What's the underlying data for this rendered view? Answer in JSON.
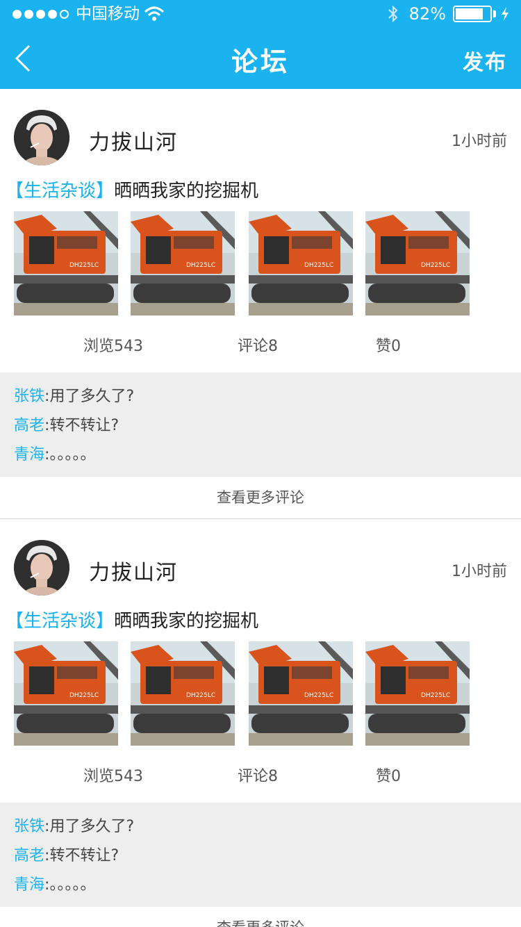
{
  "status_bar": {
    "carrier": "中国移动",
    "battery_percent": "82%",
    "battery_level": 0.82
  },
  "nav": {
    "title": "论坛",
    "publish_label": "发布"
  },
  "colors": {
    "accent": "#1ab2ef",
    "comment_bg": "#eeeeee",
    "excavator_orange": "#d9541c"
  },
  "posts": [
    {
      "username": "力拔山河",
      "time": "1小时前",
      "category": "【生活杂谈】",
      "title": "晒晒我家的挖掘机",
      "image_icon": "excavator-photo",
      "image_count": 4,
      "stats": {
        "views": "浏览543",
        "comments": "评论8",
        "likes": "赞0"
      },
      "comments": [
        {
          "user": "张铁",
          "sep": ":",
          "text": "用了多久了?"
        },
        {
          "user": "高老",
          "sep": ":",
          "text": "转不转让?"
        },
        {
          "user": "青海",
          "sep": ":",
          "text": "。。。。。"
        }
      ],
      "more_label": "查看更多评论"
    },
    {
      "username": "力拔山河",
      "time": "1小时前",
      "category": "【生活杂谈】",
      "title": "晒晒我家的挖掘机",
      "image_icon": "excavator-photo",
      "image_count": 4,
      "stats": {
        "views": "浏览543",
        "comments": "评论8",
        "likes": "赞0"
      },
      "comments": [
        {
          "user": "张铁",
          "sep": ":",
          "text": "用了多久了?"
        },
        {
          "user": "高老",
          "sep": ":",
          "text": "转不转让?"
        },
        {
          "user": "青海",
          "sep": ":",
          "text": "。。。。。"
        }
      ],
      "more_label": "查看更多评论"
    }
  ]
}
